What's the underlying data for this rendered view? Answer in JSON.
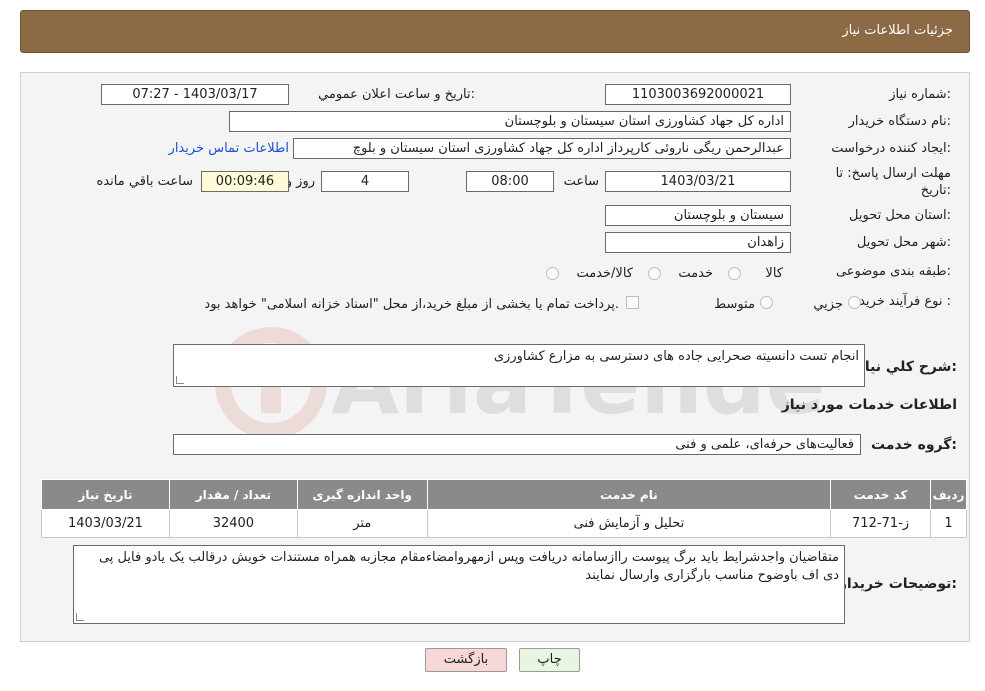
{
  "header": {
    "title": "جزئيات اطلاعات نياز"
  },
  "fields": {
    "need_number": {
      "label": "شماره نياز:",
      "value": "1103003692000021"
    },
    "announce_datetime": {
      "label": "تاريخ و ساعت اعلان عمومي:",
      "value": "1403/03/17 - 07:27"
    },
    "buyer_org": {
      "label": "نام دستگاه خريدار:",
      "value": "اداره كل جهاد كشاورزی استان سيستان و بلوچستان"
    },
    "requester": {
      "label": "ايجاد كننده درخواست:",
      "value": "عبدالرحمن ريگی ناروئی كارپرداز اداره كل جهاد كشاورزی استان سيستان و بلوچ"
    },
    "contact_link": "اطلاعات تماس خريدار",
    "deadline": {
      "label": "مهلت ارسال پاسخ: تا تاريخ:",
      "date": "1403/03/21",
      "time_label": "ساعت",
      "time": "08:00",
      "days": "4",
      "days_label": "روز و",
      "remaining": "00:09:46",
      "remaining_label": "ساعت باقي مانده"
    },
    "delivery_province": {
      "label": "استان محل تحويل:",
      "value": "سيستان و بلوچستان"
    },
    "delivery_city": {
      "label": "شهر محل تحويل:",
      "value": "زاهدان"
    },
    "subject_category": {
      "label": "طبقه بندی موضوعی:",
      "options": [
        "كالا",
        "خدمت",
        "كالا/خدمت"
      ]
    },
    "purchase_type": {
      "label": "نوع فرآيند خريد :",
      "options": [
        "جزيي",
        "متوسط"
      ],
      "payment_note": "پرداخت تمام يا بخشی از مبلغ خريد،از محل \"اسناد خزانه اسلامی\" خواهد بود."
    },
    "summary": {
      "label": "شرح كلي نياز:",
      "value": "انجام تست دانسيته صحرايی جاده های دسترسی به مزارع كشاورزی"
    }
  },
  "services": {
    "section_title": "اطلاعات خدمات مورد نياز",
    "group_label": "گروه خدمت:",
    "group_value": "فعاليت‌های حرفه‌ای، علمی و فنی",
    "table": {
      "headers": [
        "رديف",
        "كد خدمت",
        "نام خدمت",
        "واحد اندازه گيری",
        "تعداد / مقدار",
        "تاريخ نياز"
      ],
      "rows": [
        [
          "1",
          "ز-71-712",
          "تحليل و آزمايش فنی",
          "متر",
          "32400",
          "1403/03/21"
        ]
      ]
    }
  },
  "buyer_notes": {
    "label": "توضيحات خريدار:",
    "value": "متقاضيان واجدشرايط بايد برگ پيوست رااز‌سامانه دريافت وپس ازمهروامضاءمقام مجازبه همراه مستندات  خويش درقالب يک يادو فايل پی دی اف باوضوح مناسب بارگزاری وارسال نمايند"
  },
  "buttons": {
    "print": "چاپ",
    "back": "بازگشت"
  },
  "colors": {
    "header_bg": "#8b6a45",
    "link": "#1a4fd1",
    "table_header": "#8a8a8a",
    "back_button": "#f8d7d7",
    "print_button": "#e8f5e0"
  }
}
